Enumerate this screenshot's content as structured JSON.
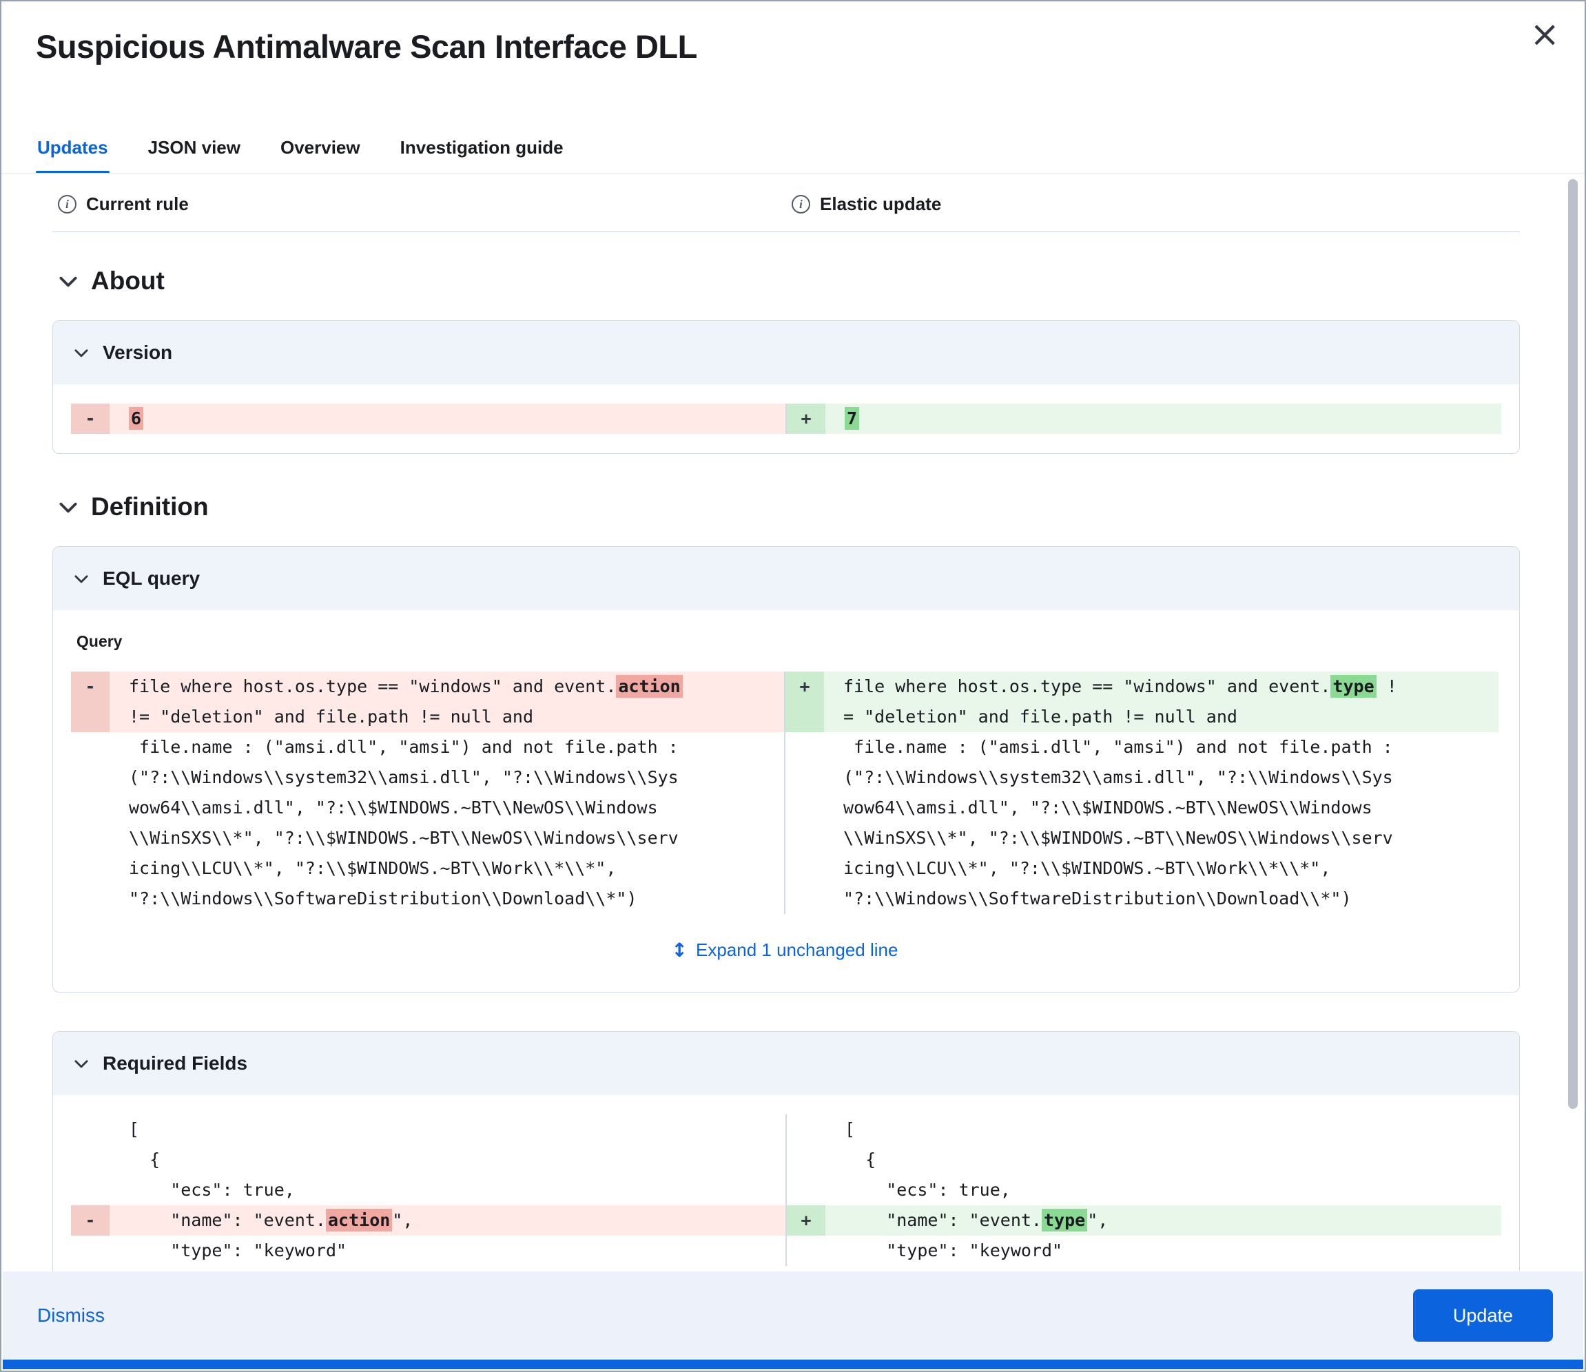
{
  "colors": {
    "accent": "#0b64dd",
    "removed_bg": "#ffeae8",
    "removed_gutter": "#f5cdc8",
    "removed_mark": "#f0a8a0",
    "added_bg": "#e9f7ea",
    "added_gutter": "#cbecce",
    "added_mark": "#8bda93",
    "panel_header_bg": "#eff3fa",
    "border": "#d3dae6"
  },
  "icons": {
    "close": "×",
    "info": "i",
    "expand": "↕"
  },
  "flyout": {
    "title": "Suspicious Antimalware Scan Interface DLL"
  },
  "tabs": {
    "updates": "Updates",
    "json_view": "JSON view",
    "overview": "Overview",
    "investigation_guide": "Investigation guide"
  },
  "compare": {
    "left": "Current rule",
    "right": "Elastic update"
  },
  "sections": {
    "about": "About",
    "definition": "Definition"
  },
  "panels": {
    "version": {
      "title": "Version"
    },
    "eql": {
      "title": "EQL query",
      "query_label": "Query",
      "expand_link": "Expand 1 unchanged line"
    },
    "required_fields": {
      "title": "Required Fields"
    }
  },
  "diff": {
    "version": {
      "left": {
        "lines": [
          {
            "cls": "rem",
            "g": "-",
            "segs": [
              {
                "t": "6",
                "m": 1
              }
            ]
          }
        ]
      },
      "right": {
        "lines": [
          {
            "cls": "add",
            "g": "+",
            "segs": [
              {
                "t": "7",
                "m": 1
              }
            ]
          }
        ]
      }
    },
    "eql": {
      "left": {
        "lines": [
          {
            "cls": "rem",
            "g": "-",
            "segs": [
              {
                "t": "file where host.os.type == \"windows\" and event."
              },
              {
                "t": "action",
                "m": 1
              }
            ]
          },
          {
            "cls": "rem",
            "segs": [
              {
                "t": "!= \"deletion\" and file.path != null and"
              }
            ]
          },
          {
            "cls": "ctx",
            "segs": [
              {
                "t": " file.name : (\"amsi.dll\", \"amsi\") and not file.path :"
              }
            ]
          },
          {
            "cls": "ctx",
            "segs": [
              {
                "t": "(\"?:\\\\Windows\\\\system32\\\\amsi.dll\", \"?:\\\\Windows\\\\Sys"
              }
            ]
          },
          {
            "cls": "ctx",
            "segs": [
              {
                "t": "wow64\\\\amsi.dll\", \"?:\\\\$WINDOWS.~BT\\\\NewOS\\\\Windows"
              }
            ]
          },
          {
            "cls": "ctx",
            "segs": [
              {
                "t": "\\\\WinSXS\\\\*\", \"?:\\\\$WINDOWS.~BT\\\\NewOS\\\\Windows\\\\serv"
              }
            ]
          },
          {
            "cls": "ctx",
            "segs": [
              {
                "t": "icing\\\\LCU\\\\*\", \"?:\\\\$WINDOWS.~BT\\\\Work\\\\*\\\\*\","
              }
            ]
          },
          {
            "cls": "ctx",
            "segs": [
              {
                "t": "\"?:\\\\Windows\\\\SoftwareDistribution\\\\Download\\\\*\")"
              }
            ]
          }
        ]
      },
      "right": {
        "lines": [
          {
            "cls": "add",
            "g": "+",
            "segs": [
              {
                "t": "file where host.os.type == \"windows\" and event."
              },
              {
                "t": "type",
                "m": 1
              },
              {
                "t": " !"
              }
            ]
          },
          {
            "cls": "add",
            "segs": [
              {
                "t": "= \"deletion\" and file.path != null and"
              }
            ]
          },
          {
            "cls": "ctx",
            "segs": [
              {
                "t": " file.name : (\"amsi.dll\", \"amsi\") and not file.path :"
              }
            ]
          },
          {
            "cls": "ctx",
            "segs": [
              {
                "t": "(\"?:\\\\Windows\\\\system32\\\\amsi.dll\", \"?:\\\\Windows\\\\Sys"
              }
            ]
          },
          {
            "cls": "ctx",
            "segs": [
              {
                "t": "wow64\\\\amsi.dll\", \"?:\\\\$WINDOWS.~BT\\\\NewOS\\\\Windows"
              }
            ]
          },
          {
            "cls": "ctx",
            "segs": [
              {
                "t": "\\\\WinSXS\\\\*\", \"?:\\\\$WINDOWS.~BT\\\\NewOS\\\\Windows\\\\serv"
              }
            ]
          },
          {
            "cls": "ctx",
            "segs": [
              {
                "t": "icing\\\\LCU\\\\*\", \"?:\\\\$WINDOWS.~BT\\\\Work\\\\*\\\\*\","
              }
            ]
          },
          {
            "cls": "ctx",
            "segs": [
              {
                "t": "\"?:\\\\Windows\\\\SoftwareDistribution\\\\Download\\\\*\")"
              }
            ]
          }
        ]
      }
    },
    "required_fields": {
      "left": {
        "lines": [
          {
            "cls": "ctx",
            "segs": [
              {
                "t": "["
              }
            ]
          },
          {
            "cls": "ctx",
            "segs": [
              {
                "t": "  {"
              }
            ]
          },
          {
            "cls": "ctx",
            "segs": [
              {
                "t": "    \"ecs\": true,"
              }
            ]
          },
          {
            "cls": "rem",
            "g": "-",
            "segs": [
              {
                "t": "    \"name\": \"event."
              },
              {
                "t": "action",
                "m": 1
              },
              {
                "t": "\","
              }
            ]
          },
          {
            "cls": "ctx",
            "segs": [
              {
                "t": "    \"type\": \"keyword\""
              }
            ]
          }
        ]
      },
      "right": {
        "lines": [
          {
            "cls": "ctx",
            "segs": [
              {
                "t": "["
              }
            ]
          },
          {
            "cls": "ctx",
            "segs": [
              {
                "t": "  {"
              }
            ]
          },
          {
            "cls": "ctx",
            "segs": [
              {
                "t": "    \"ecs\": true,"
              }
            ]
          },
          {
            "cls": "add",
            "g": "+",
            "segs": [
              {
                "t": "    \"name\": \"event."
              },
              {
                "t": "type",
                "m": 1
              },
              {
                "t": "\","
              }
            ]
          },
          {
            "cls": "ctx",
            "segs": [
              {
                "t": "    \"type\": \"keyword\""
              }
            ]
          }
        ]
      }
    }
  },
  "footer": {
    "dismiss": "Dismiss",
    "update": "Update"
  }
}
